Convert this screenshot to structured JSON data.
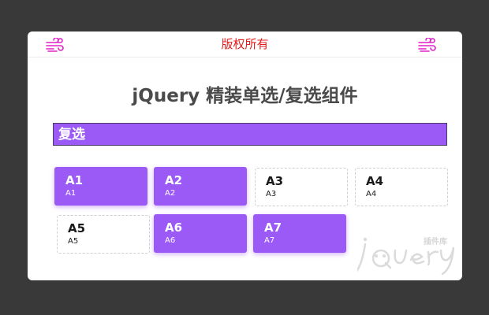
{
  "header": {
    "copyright": "版权所有",
    "left_icon": "wind-icon",
    "right_icon": "wind-icon"
  },
  "title": "jQuery 精装单选/复选组件",
  "section": {
    "label": "复选"
  },
  "options": [
    {
      "title": "A1",
      "sub": "A1",
      "checked": true
    },
    {
      "title": "A2",
      "sub": "A2",
      "checked": true
    },
    {
      "title": "A3",
      "sub": "A3",
      "checked": false
    },
    {
      "title": "A4",
      "sub": "A4",
      "checked": false
    },
    {
      "title": "A5",
      "sub": "A5",
      "checked": false
    },
    {
      "title": "A6",
      "sub": "A6",
      "checked": true
    },
    {
      "title": "A7",
      "sub": "A7",
      "checked": true
    }
  ],
  "watermark": {
    "brand": "jQuery",
    "tag": "插件库"
  },
  "colors": {
    "page_bg": "#393939",
    "accent": "#9b59f6",
    "copyright": "#e01e1e",
    "icon": "#e020c8"
  }
}
